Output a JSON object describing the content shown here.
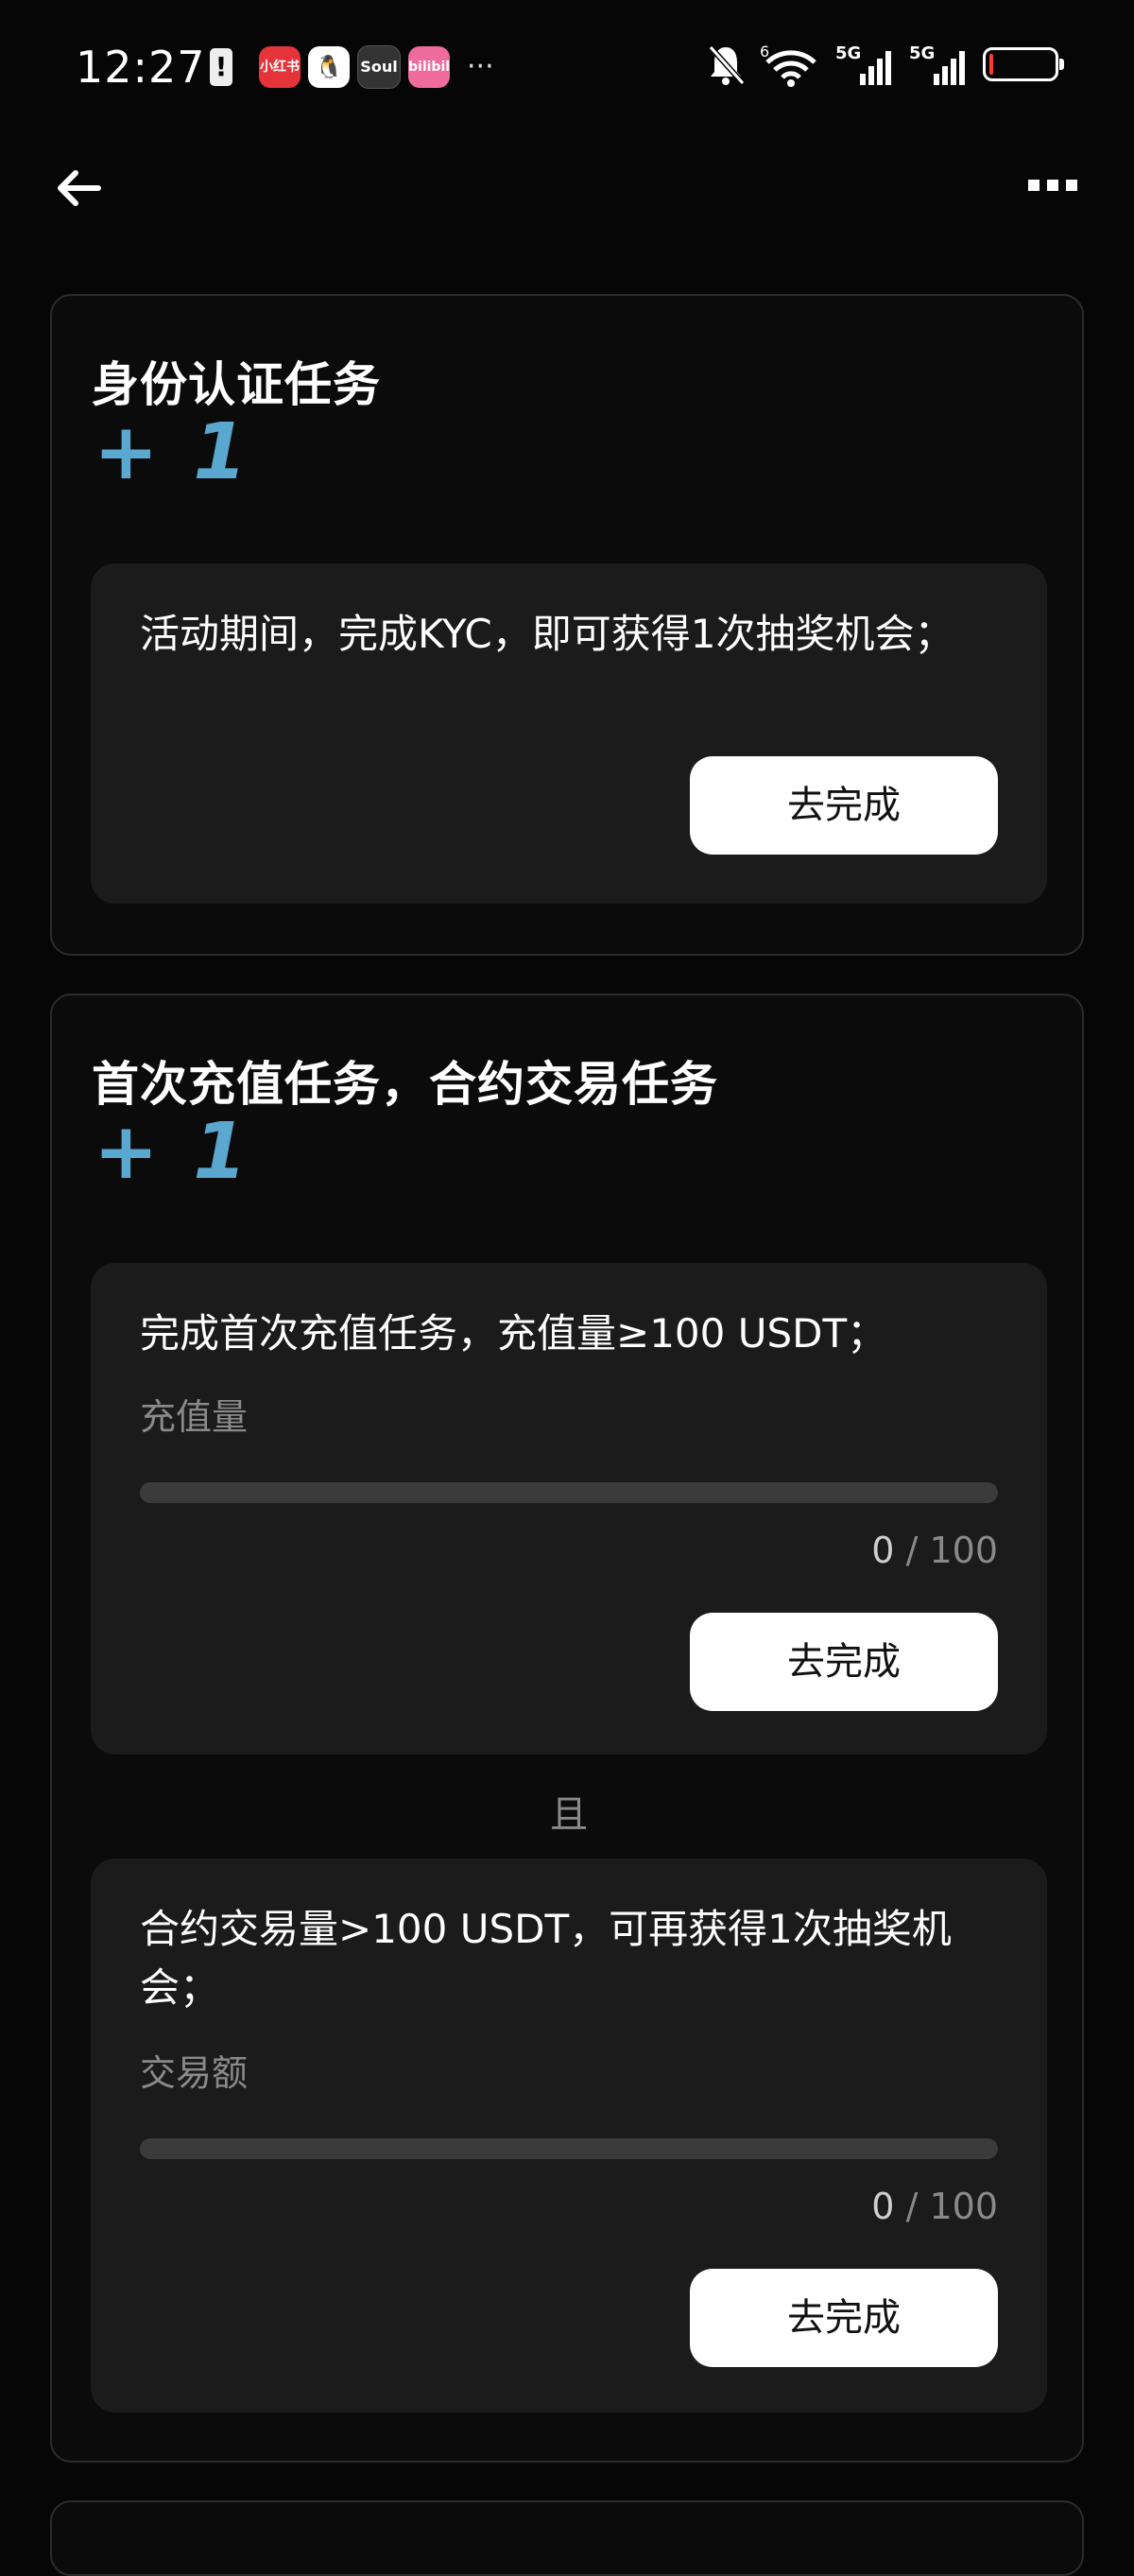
{
  "status_bar": {
    "time": "12:27",
    "notif_icon": "!",
    "apps": [
      "小红书",
      "QQ",
      "Soul",
      "bilibili"
    ],
    "more": "···",
    "network_labels": [
      "5G",
      "5G"
    ],
    "wifi_label": "6"
  },
  "header": {
    "back_icon": "arrow-left",
    "menu_icon": "more-horizontal"
  },
  "kyc_card": {
    "title": "身份认证任务",
    "reward": "+ 1",
    "description": "活动期间，完成KYC，即可获得1次抽奖机会；",
    "button_label": "去完成"
  },
  "deposit_card": {
    "title": "首次充值任务，合约交易任务",
    "reward": "+ 1",
    "task1": {
      "description": "完成首次充值任务，充值量≥100 USDT；",
      "label": "充值量",
      "current": "0",
      "separator": "/",
      "total": "100",
      "progress": 0,
      "button_label": "去完成"
    },
    "and_label": "且",
    "task2": {
      "description": "合约交易量>100 USDT，可再获得1次抽奖机会；",
      "label": "交易额",
      "current": "0",
      "separator": "/",
      "total": "100",
      "progress": 0,
      "button_label": "去完成"
    }
  },
  "colors": {
    "accent": "#5aa7d0",
    "background": "#060606",
    "card_inner": "#1b1b1c"
  }
}
